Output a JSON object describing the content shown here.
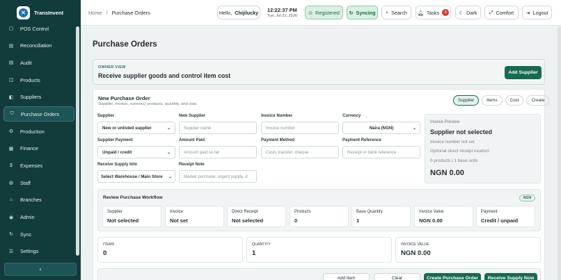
{
  "brand": {
    "name": "TransInvent",
    "logo_glyph": "✕"
  },
  "sidebar": {
    "items": [
      {
        "label": "POS Control",
        "icon": "pos-icon",
        "glyph": "▢"
      },
      {
        "label": "Reconciliation",
        "icon": "reconcile-icon",
        "glyph": "▤"
      },
      {
        "label": "Audit",
        "icon": "audit-icon",
        "glyph": "▤"
      },
      {
        "label": "Products",
        "icon": "box-icon",
        "glyph": "◫"
      },
      {
        "label": "Suppliers",
        "icon": "truck-icon",
        "glyph": "◧"
      },
      {
        "label": "Purchase Orders",
        "icon": "cart-icon",
        "glyph": "⛉"
      },
      {
        "label": "Production",
        "icon": "production-icon",
        "glyph": "⚙"
      },
      {
        "label": "Finance",
        "icon": "finance-icon",
        "glyph": "▦"
      },
      {
        "label": "Expenses",
        "icon": "expenses-icon",
        "glyph": "$"
      },
      {
        "label": "Staff",
        "icon": "staff-icon",
        "glyph": "◍"
      },
      {
        "label": "Branches",
        "icon": "branches-icon",
        "glyph": "⌂"
      },
      {
        "label": "Admin",
        "icon": "admin-icon",
        "glyph": "◉"
      },
      {
        "label": "Sync",
        "icon": "sync-icon",
        "glyph": "↻"
      },
      {
        "label": "Settings",
        "icon": "settings-icon",
        "glyph": "☰"
      }
    ],
    "collapse_glyph": "‹"
  },
  "topbar": {
    "breadcrumb_home": "Home",
    "breadcrumb_sep": "/",
    "breadcrumb_current": "Purchase Orders",
    "hello_prefix": "Hello,",
    "hello_user": "Chijilucky",
    "time": "12:22:37 PM",
    "date": "Tue, Jul 21, 2026",
    "registered": "Registered",
    "syncing": "Syncing",
    "search": "Search",
    "tasks": "Tasks",
    "tasks_count": "6",
    "dark": "Dark",
    "comfort": "Comfort",
    "logout": "Logout"
  },
  "page": {
    "title": "Purchase Orders"
  },
  "owner": {
    "kicker": "OWNER VIEW",
    "title": "Receive supplier goods and control item cost",
    "add_supplier": "Add Supplier"
  },
  "po": {
    "title": "New Purchase Order",
    "subtitle": "Supplier, invoice, currency, products, quantity, and cost.",
    "tabs": [
      "Supplier",
      "Items",
      "Cost",
      "Create"
    ],
    "fields": {
      "supplier_label": "Supplier",
      "supplier_value": "New or unlisted supplier",
      "new_supplier_label": "New Supplier",
      "new_supplier_placeholder": "Supplier name",
      "invoice_label": "Invoice Number",
      "invoice_placeholder": "Invoice number",
      "currency_label": "Currency",
      "currency_value": "Naira (NGN)",
      "payment_label": "Supplier Payment",
      "payment_value": "Unpaid / credit",
      "amount_label": "Amount Paid",
      "amount_placeholder": "Amount paid so far",
      "method_label": "Payment Method",
      "method_placeholder": "Cash, transfer, cheque",
      "reference_label": "Payment Reference",
      "reference_placeholder": "Receipt or bank reference",
      "receive_label": "Receive Supply Into",
      "receive_value": "Select Warehouse / Main Store",
      "note_label": "Receipt Note",
      "note_placeholder": "Market purchase, urgent supply, d"
    },
    "preview": {
      "kicker": "Invoice Preview",
      "title": "Supplier not selected",
      "line1": "Invoice number not set",
      "line2": "Optional direct receipt location",
      "line3": "0 products | 1 base units",
      "total": "NGN 0.00"
    },
    "workflow": {
      "title": "Review Purchase Workflow",
      "badge": "NGN",
      "cells": [
        {
          "k": "Supplier",
          "v": "Not selected"
        },
        {
          "k": "Invoice",
          "v": "Not set"
        },
        {
          "k": "Direct Receipt",
          "v": "Not selected"
        },
        {
          "k": "Products",
          "v": "0"
        },
        {
          "k": "Base Quantity",
          "v": "1"
        },
        {
          "k": "Invoice Value",
          "v": "NGN 0.00"
        },
        {
          "k": "Payment",
          "v": "Credit / unpaid"
        }
      ]
    },
    "stats": [
      {
        "k": "ITEMS",
        "v": "0"
      },
      {
        "k": "QUANTITY",
        "v": "1"
      },
      {
        "k": "INVOICE VALUE",
        "v": "NGN 0.00"
      }
    ],
    "actions": {
      "add_item": "Add Item",
      "clear": "Clear",
      "create": "Create Purchase Order",
      "receive": "Receive Supply Now"
    }
  },
  "colors": {
    "sidebar": "#123b3c",
    "accent": "#176a52",
    "badge": "#d93c35"
  }
}
